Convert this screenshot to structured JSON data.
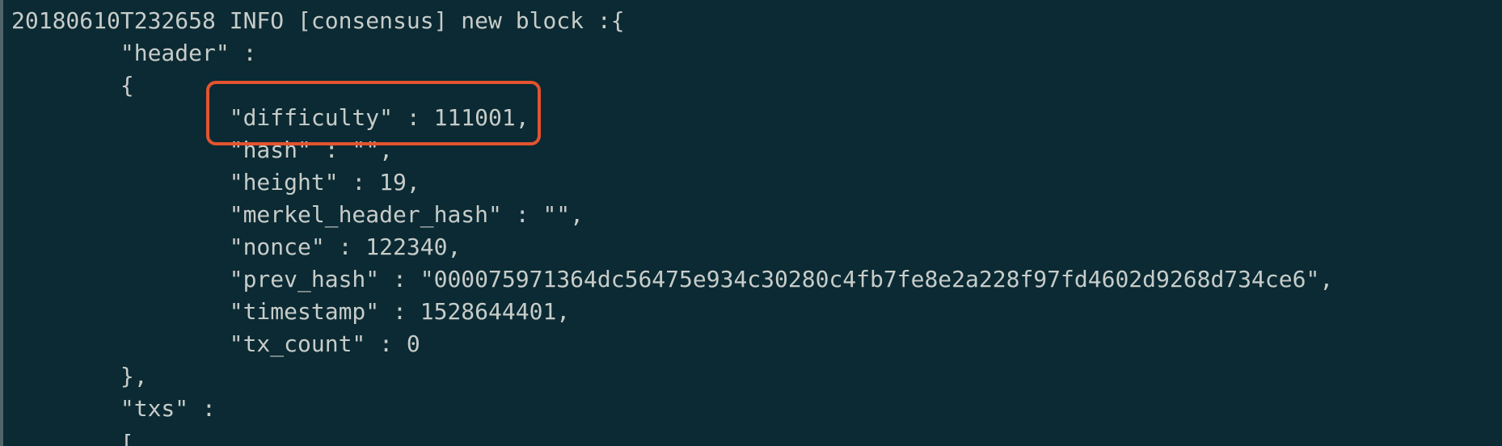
{
  "terminal": {
    "lines": [
      "20180610T232658 INFO [consensus] new block :{",
      "        \"header\" :",
      "        {",
      "                \"difficulty\" : 111001,",
      "                \"hash\" : \"\",",
      "                \"height\" : 19,",
      "                \"merkel_header_hash\" : \"\",",
      "                \"nonce\" : 122340,",
      "                \"prev_hash\" : \"000075971364dc56475e934c30280c4fb7fe8e2a228f97fd4602d9268d734ce6\",",
      "                \"timestamp\" : 1528644401,",
      "                \"tx_count\" : 0",
      "        },",
      "        \"txs\" :",
      "        ["
    ]
  },
  "colors": {
    "background": "#0b2a33",
    "text": "#c7ccc9",
    "highlight_border": "#e4532e"
  }
}
